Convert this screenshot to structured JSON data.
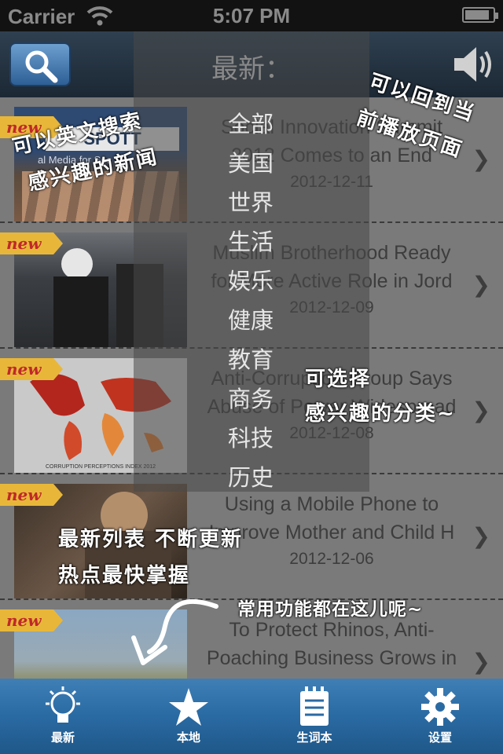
{
  "status": {
    "carrier": "Carrier",
    "time": "5:07 PM"
  },
  "header": {
    "title": "最新",
    "title_suffix": "："
  },
  "categories": [
    "全部",
    "美国",
    "世界",
    "生活",
    "娱乐",
    "健康",
    "教育",
    "商务",
    "科技",
    "历史"
  ],
  "badge_text": "new",
  "articles": [
    {
      "title_line1": "Social Innovation Summit",
      "title_line2": "2012 Comes to an End",
      "date": "2012-12-11",
      "thumb_text": "SPOTT",
      "thumb_subtext": "al Media for Soc"
    },
    {
      "title_line1": "Muslim Brotherhood Ready",
      "title_line2": "for More Active Role in Jord",
      "date": "2012-12-09"
    },
    {
      "title_line1": "Anti-Corruption Group Says",
      "title_line2": "Abuse of Power Widespread",
      "date": "2012-12-08",
      "thumb_text": "CORRUPTION PERCEPTIONS INDEX 2012"
    },
    {
      "title_line1": "Using a Mobile Phone to",
      "title_line2": "Improve Mother and Child H",
      "date": "2012-12-06"
    },
    {
      "title_line1": "To Protect Rhinos, Anti-",
      "title_line2": "Poaching Business Grows in",
      "date": ""
    }
  ],
  "annotations": {
    "search_line1": "可以英文搜索",
    "search_line2": "感兴趣的新闻",
    "speaker_line1": "可以回到当",
    "speaker_line2": "前播放页面",
    "category_line1": "可选择",
    "category_line2": "感兴趣的分类~",
    "list_line1": "最新列表 不断更新",
    "list_line2": "热点最快掌握",
    "tabbar_note": "常用功能都在这儿呢~"
  },
  "tabs": [
    {
      "label": "最新",
      "icon": "lightbulb-icon"
    },
    {
      "label": "本地",
      "icon": "star-icon"
    },
    {
      "label": "生词本",
      "icon": "notepad-icon"
    },
    {
      "label": "设置",
      "icon": "gear-icon"
    }
  ],
  "colors": {
    "tabbar": "#2a6aa3",
    "badge": "#e8b73a",
    "badge_text": "#c0282a"
  }
}
